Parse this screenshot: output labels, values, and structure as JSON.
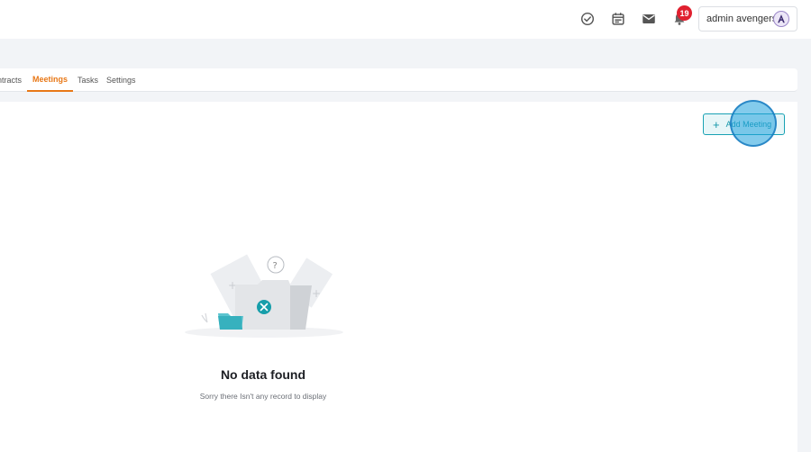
{
  "header": {
    "notification_count": "19",
    "user_name": "admin avengers",
    "icons": [
      "check-circle-icon",
      "calendar-icon",
      "mail-icon",
      "bell-icon"
    ]
  },
  "tabs": [
    {
      "label": "ntracts",
      "active": false
    },
    {
      "label": "Meetings",
      "active": true
    },
    {
      "label": "Tasks",
      "active": false
    },
    {
      "label": "Settings",
      "active": false
    }
  ],
  "toolbar": {
    "add_label": "Add Meeting",
    "add_icon": "plus-icon"
  },
  "empty_state": {
    "title": "No data found",
    "subtitle": "Sorry there Isn't any record to display"
  },
  "colors": {
    "accent": "#e87817",
    "teal": "#19a2b4",
    "badge": "#e0202f"
  }
}
